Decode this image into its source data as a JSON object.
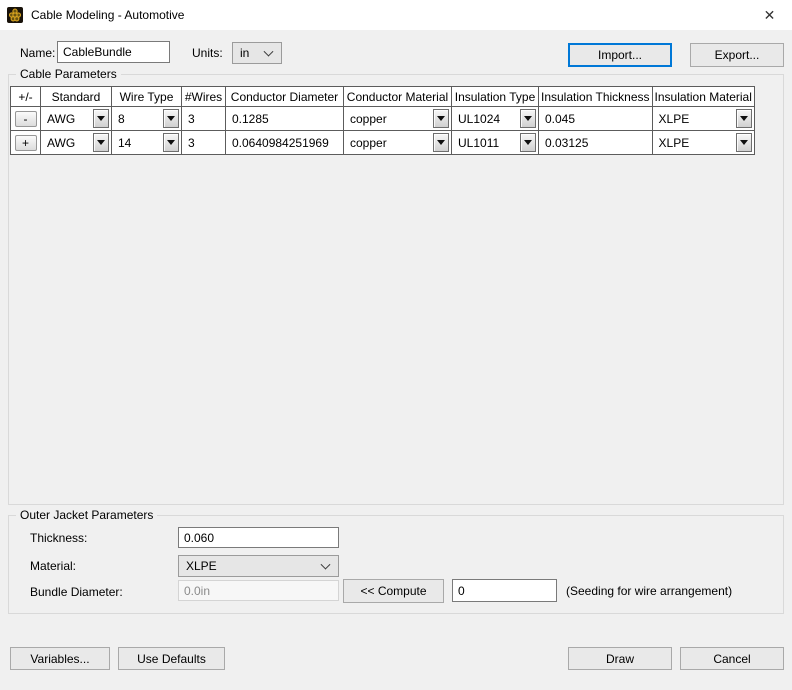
{
  "window": {
    "title": "Cable Modeling - Automotive"
  },
  "icons": {
    "close": "✕"
  },
  "colors": {
    "accent_focus": "#0078d7",
    "dialog_bg": "#f0f0f0",
    "titlebar_bg": "#ffffff"
  },
  "header": {
    "name_label": "Name:",
    "name_value": "CableBundle",
    "units_label": "Units:",
    "units_value": "in",
    "import_label": "Import...",
    "export_label": "Export..."
  },
  "cable_parameters": {
    "group_label": "Cable Parameters",
    "columns": [
      "+/-",
      "Standard",
      "Wire Type",
      "#Wires",
      "Conductor Diameter",
      "Conductor Material",
      "Insulation Type",
      "Insulation Thickness",
      "Insulation Material"
    ],
    "rows": [
      {
        "action": "-",
        "standard": "AWG",
        "wire_type": "8",
        "num_wires": "3",
        "conductor_diameter": "0.1285",
        "conductor_material": "copper",
        "insulation_type": "UL1024",
        "insulation_thickness": "0.045",
        "insulation_material": "XLPE"
      },
      {
        "action": "+",
        "standard": "AWG",
        "wire_type": "14",
        "num_wires": "3",
        "conductor_diameter": "0.0640984251969",
        "conductor_material": "copper",
        "insulation_type": "UL1011",
        "insulation_thickness": "0.03125",
        "insulation_material": "XLPE"
      }
    ]
  },
  "outer_jacket": {
    "group_label": "Outer Jacket Parameters",
    "thickness_label": "Thickness:",
    "thickness_value": "0.060",
    "material_label": "Material:",
    "material_value": "XLPE",
    "bundle_diameter_label": "Bundle Diameter:",
    "bundle_diameter_value": "0.0in",
    "compute_label": "<< Compute",
    "seed_value": "0",
    "seeding_note": "(Seeding for wire arrangement)"
  },
  "footer": {
    "variables_label": "Variables...",
    "use_defaults_label": "Use Defaults",
    "draw_label": "Draw",
    "cancel_label": "Cancel"
  }
}
